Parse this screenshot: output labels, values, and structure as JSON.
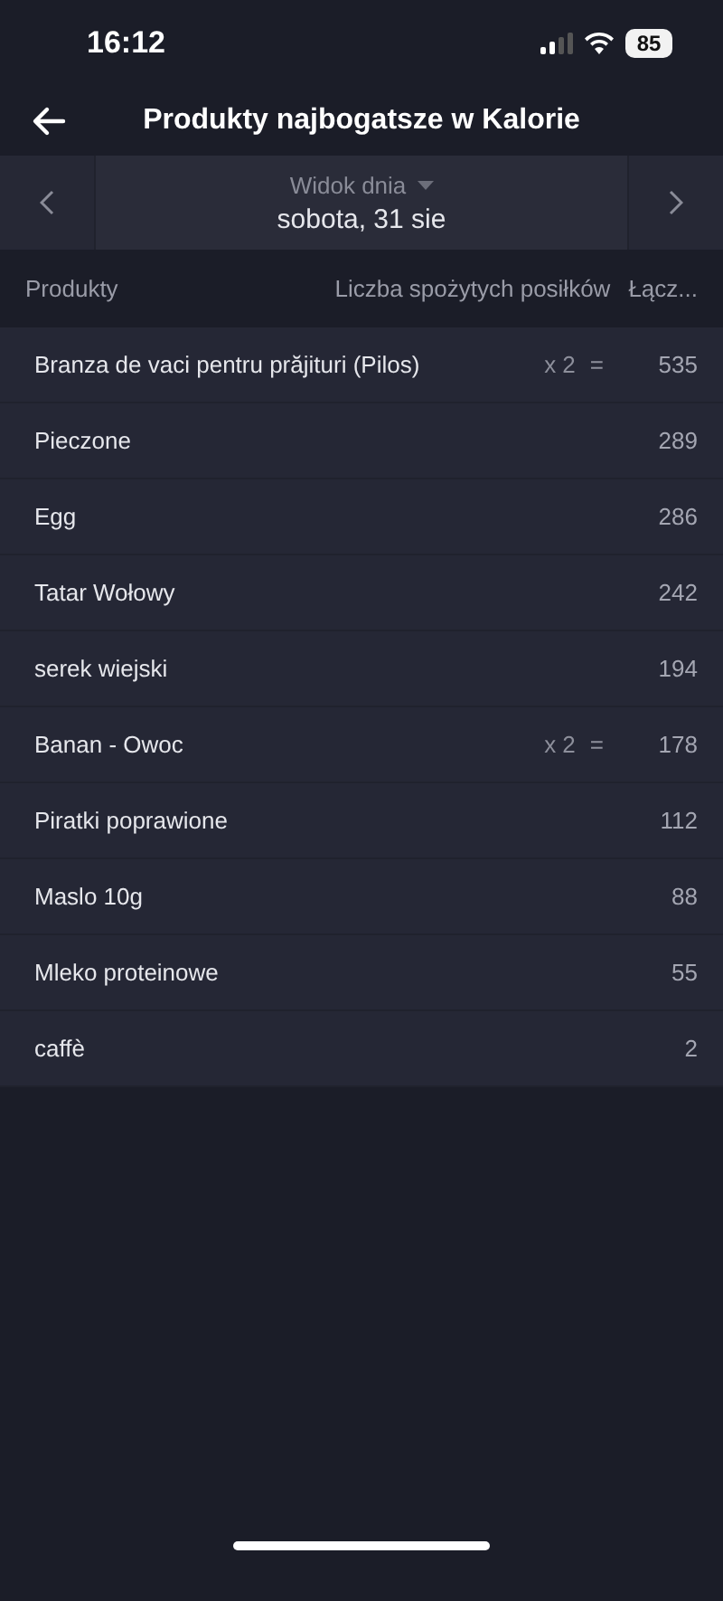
{
  "status_bar": {
    "time": "16:12",
    "battery": "85"
  },
  "header": {
    "title": "Produkty najbogatsze w Kalorie"
  },
  "date_nav": {
    "view": "Widok dnia",
    "date": "sobota, 31 sie"
  },
  "table": {
    "columns": [
      "Produkty",
      "Liczba spożytych posiłków",
      "Łącz..."
    ],
    "rows": [
      {
        "name": "Branza de vaci pentru prăjituri (Pilos)",
        "count": "x 2",
        "equals": "=",
        "value": "535"
      },
      {
        "name": "Pieczone",
        "value": "289"
      },
      {
        "name": "Egg",
        "value": "286"
      },
      {
        "name": "Tatar Wołowy",
        "value": "242"
      },
      {
        "name": "serek wiejski",
        "value": "194"
      },
      {
        "name": "Banan - Owoc",
        "count": "x 2",
        "equals": "=",
        "value": "178"
      },
      {
        "name": "Piratki poprawione",
        "value": "112"
      },
      {
        "name": "Maslo 10g",
        "value": "88"
      },
      {
        "name": "Mleko proteinowe",
        "value": "55"
      },
      {
        "name": "caffè",
        "value": "2"
      }
    ]
  }
}
